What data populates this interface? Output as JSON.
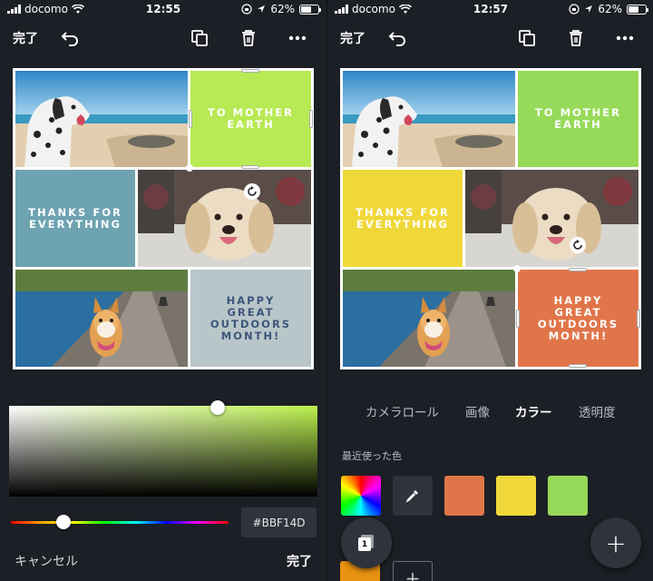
{
  "left": {
    "status": {
      "carrier": "docomo",
      "time": "12:55",
      "battery": "62%",
      "battery_level": 0.62
    },
    "toolbar": {
      "done": "完了"
    },
    "tiles": {
      "top_right": {
        "text": "TO MOTHER EARTH",
        "color": "#b8ea55"
      },
      "mid_left": {
        "text": "THANKS FOR EVERYTHING",
        "color": "#6ea3b2"
      },
      "bottom_right": {
        "text": "HAPPY GREAT OUTDOORS MONTH!",
        "color": "#b9c6c9",
        "text_color": "#3c567a"
      }
    },
    "picker": {
      "hex": "#BBF14D",
      "cancel": "キャンセル",
      "confirm": "完了"
    }
  },
  "right": {
    "status": {
      "carrier": "docomo",
      "time": "12:57",
      "battery": "62%",
      "battery_level": 0.62
    },
    "toolbar": {
      "done": "完了"
    },
    "tiles": {
      "top_right": {
        "text": "TO MOTHER EARTH",
        "color": "#97da59"
      },
      "mid_left": {
        "text": "THANKS FOR EVERYTHING",
        "color": "#f0d83a"
      },
      "bottom_right": {
        "text": "HAPPY GREAT OUTDOORS MONTH!",
        "color": "#e1754a",
        "text_color": "#ffffff"
      }
    },
    "tabs": [
      "カメラロール",
      "画像",
      "カラー",
      "透明度"
    ],
    "active_tab": "カラー",
    "recent_label": "最近使った色",
    "recent_colors": [
      "#e1754a",
      "#f0d83a",
      "#97da59"
    ],
    "page_badge": "1"
  }
}
